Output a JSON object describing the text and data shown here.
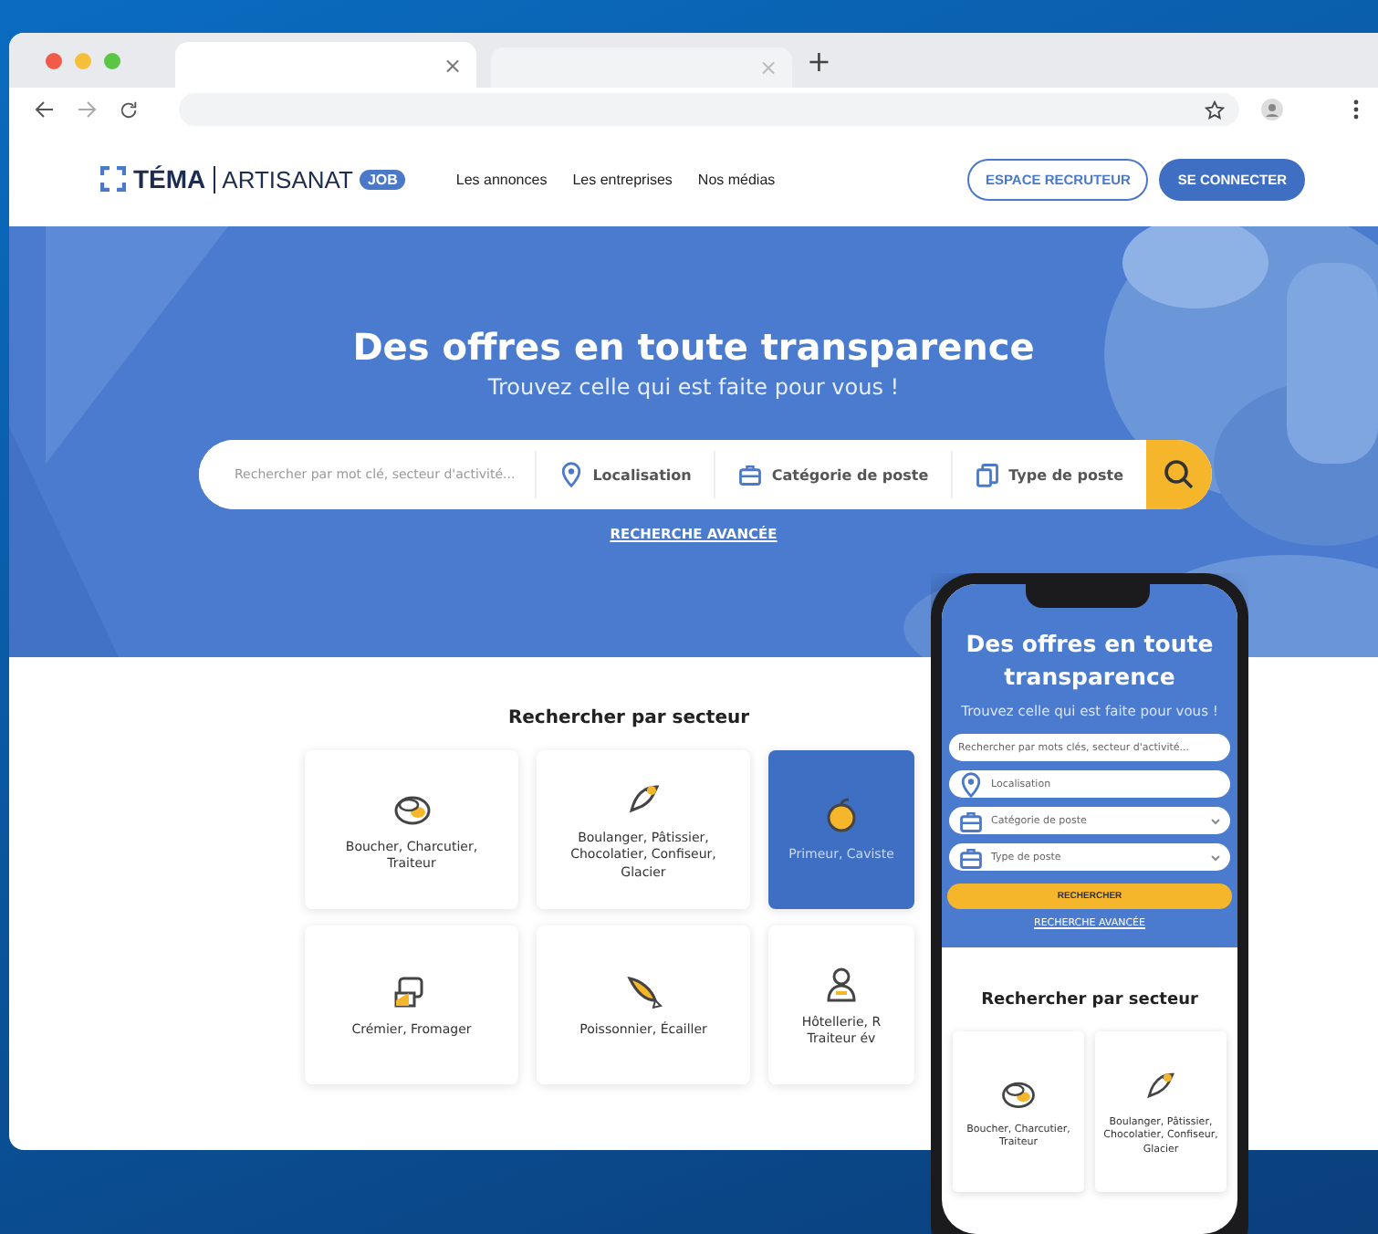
{
  "browser": {
    "tabs": [
      {
        "close": "×",
        "selected": true
      },
      {
        "close": "×",
        "selected": false
      }
    ],
    "new_tab": "+"
  },
  "site_nav": {
    "logo": {
      "brand": "TÉMA",
      "name": "ARTISANAT",
      "badge": "JOB"
    },
    "links": [
      "Les annonces",
      "Les entreprises",
      "Nos médias"
    ],
    "buttons": [
      {
        "label": "ESPACE RECRUTEUR",
        "kind": "outline"
      },
      {
        "label": "SE CONNECTER",
        "kind": "filled"
      }
    ]
  },
  "hero": {
    "title": "Des offres en toute transparence",
    "subtitle": "Trouvez celle qui est faite pour vous !",
    "search": {
      "placeholder": "Rechercher par mot clé, secteur d'activité...",
      "filters": [
        {
          "label": "Localisation",
          "kind": "location"
        },
        {
          "label": "Catégorie de poste",
          "kind": "category"
        },
        {
          "label": "Type de poste",
          "kind": "type"
        }
      ]
    },
    "advanced_link": "RECHERCHE AVANCÉE"
  },
  "sectors": {
    "title": "Rechercher par secteur",
    "items": [
      {
        "label": "Boucher, Charcutier, Traiteur",
        "kind": "meat",
        "selected": false
      },
      {
        "label": "Boulanger, Pâtissier, Chocolatier, Confiseur, Glacier",
        "kind": "bread",
        "selected": false
      },
      {
        "label": "Primeur, Caviste",
        "kind": "fruit",
        "selected": true
      },
      {
        "label": "Crémier, Fromager",
        "kind": "cheese",
        "selected": false
      },
      {
        "label": "Poissonnier, Écailler",
        "kind": "fish",
        "selected": false
      },
      {
        "label": "Hôtellerie, R Traiteur év",
        "kind": "chef",
        "selected": false
      }
    ]
  },
  "phone": {
    "title": "Des offres en toute transparence",
    "subtitle": "Trouvez celle qui est faite pour vous !",
    "fields": [
      {
        "placeholder": "Rechercher par mots clés, secteur d'activité...",
        "kind": "text"
      },
      {
        "placeholder": "Localisation",
        "kind": "location"
      },
      {
        "placeholder": "Catégorie de poste",
        "kind": "select"
      },
      {
        "placeholder": "Type de poste",
        "kind": "select"
      }
    ],
    "search_button": "RECHERCHER",
    "advanced_link": "RECHERCHE AVANCÉE",
    "sectors_title": "Rechercher par secteur",
    "sectors": [
      {
        "label": "Boucher, Charcutier, Traiteur",
        "kind": "meat"
      },
      {
        "label": "Boulanger, Pâtissier, Chocolatier, Confiseur, Glacier",
        "kind": "bread"
      }
    ]
  }
}
